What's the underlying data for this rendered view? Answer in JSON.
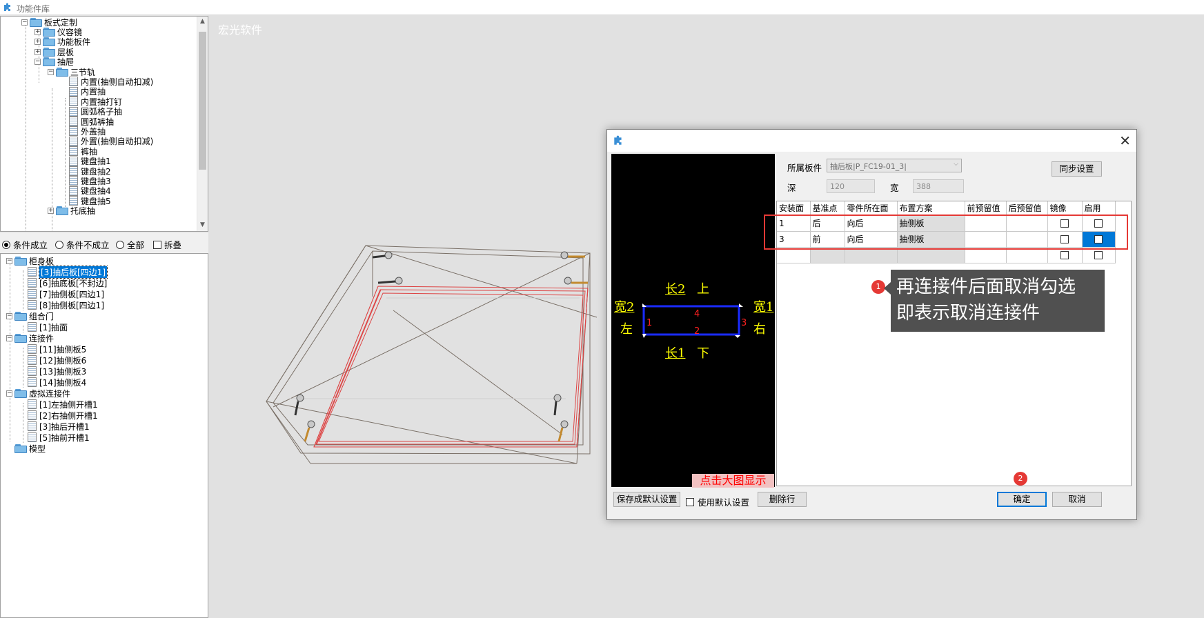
{
  "window": {
    "title": "功能件库"
  },
  "viewport": {
    "brand": "宏光软件"
  },
  "tree_top": {
    "items": [
      {
        "label": "板式定制",
        "level": 0,
        "expander": "minus",
        "kind": "folder"
      },
      {
        "label": "仪容镜",
        "level": 1,
        "expander": "plus",
        "kind": "folder"
      },
      {
        "label": "功能板件",
        "level": 1,
        "expander": "plus",
        "kind": "folder"
      },
      {
        "label": "层板",
        "level": 1,
        "expander": "plus",
        "kind": "folder"
      },
      {
        "label": "抽屉",
        "level": 1,
        "expander": "minus",
        "kind": "folder"
      },
      {
        "label": "三节轨",
        "level": 2,
        "expander": "minus",
        "kind": "folder"
      },
      {
        "label": "内置(抽侧自动扣减)",
        "level": 3,
        "kind": "doc"
      },
      {
        "label": "内置抽",
        "level": 3,
        "kind": "doc"
      },
      {
        "label": "内置抽打钉",
        "level": 3,
        "kind": "doc"
      },
      {
        "label": "圆弧格子抽",
        "level": 3,
        "kind": "doc"
      },
      {
        "label": "圆弧裤抽",
        "level": 3,
        "kind": "doc"
      },
      {
        "label": "外盖抽",
        "level": 3,
        "kind": "doc"
      },
      {
        "label": "外置(抽侧自动扣减)",
        "level": 3,
        "kind": "doc"
      },
      {
        "label": "裤抽",
        "level": 3,
        "kind": "doc"
      },
      {
        "label": "键盘抽1",
        "level": 3,
        "kind": "doc"
      },
      {
        "label": "键盘抽2",
        "level": 3,
        "kind": "doc"
      },
      {
        "label": "键盘抽3",
        "level": 3,
        "kind": "doc"
      },
      {
        "label": "键盘抽4",
        "level": 3,
        "kind": "doc"
      },
      {
        "label": "键盘抽5",
        "level": 3,
        "kind": "doc"
      },
      {
        "label": "托底抽",
        "level": 2,
        "expander": "plus",
        "kind": "folder"
      }
    ]
  },
  "filter": {
    "options": [
      "条件成立",
      "条件不成立",
      "全部"
    ],
    "selected": "条件成立",
    "collapse_label": "拆叠"
  },
  "tree_bottom": {
    "items": [
      {
        "label": "柜身板",
        "level": 0,
        "expander": "minus",
        "kind": "folder"
      },
      {
        "label": "[3]抽后板[四边1]",
        "level": 1,
        "kind": "doc",
        "selected": true
      },
      {
        "label": "[6]抽底板[不封边]",
        "level": 1,
        "kind": "doc"
      },
      {
        "label": "[7]抽侧板[四边1]",
        "level": 1,
        "kind": "doc"
      },
      {
        "label": "[8]抽侧板[四边1]",
        "level": 1,
        "kind": "doc"
      },
      {
        "label": "组合门",
        "level": 0,
        "expander": "minus",
        "kind": "folder"
      },
      {
        "label": "[1]抽面",
        "level": 1,
        "kind": "doc"
      },
      {
        "label": "连接件",
        "level": 0,
        "expander": "minus",
        "kind": "folder"
      },
      {
        "label": "[11]抽侧板5",
        "level": 1,
        "kind": "doc"
      },
      {
        "label": "[12]抽侧板6",
        "level": 1,
        "kind": "doc"
      },
      {
        "label": "[13]抽侧板3",
        "level": 1,
        "kind": "doc"
      },
      {
        "label": "[14]抽侧板4",
        "level": 1,
        "kind": "doc"
      },
      {
        "label": "虚拟连接件",
        "level": 0,
        "expander": "minus",
        "kind": "folder"
      },
      {
        "label": "[1]左抽侧开槽1",
        "level": 1,
        "kind": "doc"
      },
      {
        "label": "[2]右抽侧开槽1",
        "level": 1,
        "kind": "doc"
      },
      {
        "label": "[3]抽后开槽1",
        "level": 1,
        "kind": "doc"
      },
      {
        "label": "[5]抽前开槽1",
        "level": 1,
        "kind": "doc"
      },
      {
        "label": "模型",
        "level": 0,
        "kind": "folder"
      }
    ]
  },
  "dialog": {
    "preview": {
      "top_label": "长2",
      "top_dir": "上",
      "bottom_label": "长1",
      "bottom_dir": "下",
      "left_label": "宽2",
      "left_dir": "左",
      "right_label": "宽1",
      "right_dir": "右",
      "edge_top": "4",
      "edge_bottom": "2",
      "edge_left": "1",
      "edge_right": "3",
      "enlarge_button": "点击大图显示"
    },
    "board_label": "所属板件",
    "board_value": "抽后板|P_FC19-01_3|",
    "depth_label": "深",
    "depth_value": "120",
    "width_label": "宽",
    "width_value": "388",
    "sync_button": "同步设置",
    "grid": {
      "columns": [
        "安装面",
        "基准点",
        "零件所在面",
        "布置方案",
        "前预留值",
        "后预留值",
        "镜像",
        "启用"
      ],
      "rows": [
        {
          "face": "1",
          "base": "后",
          "part_face": "向后",
          "plan": "抽侧板",
          "front": "",
          "back": "",
          "mirror": false,
          "enabled": false
        },
        {
          "face": "3",
          "base": "前",
          "part_face": "向后",
          "plan": "抽侧板",
          "front": "",
          "back": "",
          "mirror": false,
          "enabled": false
        }
      ]
    },
    "save_default_button": "保存成默认设置",
    "use_default_label": "使用默认设置",
    "delete_row_button": "删除行",
    "ok_button": "确定",
    "cancel_button": "取消"
  },
  "annotation": {
    "badge1": "1",
    "badge2": "2",
    "tooltip_line1": "再连接件后面取消勾选",
    "tooltip_line2": "即表示取消连接件",
    "accent": "#e53935",
    "selection": "#0078d7"
  }
}
